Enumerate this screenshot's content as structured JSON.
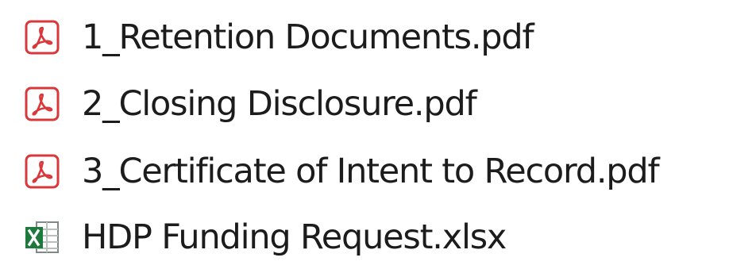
{
  "files": [
    {
      "name": "1_Retention Documents.pdf",
      "icon": "pdf-file-icon"
    },
    {
      "name": "2_Closing Disclosure.pdf",
      "icon": "pdf-file-icon"
    },
    {
      "name": "3_Certificate of Intent to Record.pdf",
      "icon": "pdf-file-icon"
    },
    {
      "name": "HDP Funding Request.xlsx",
      "icon": "excel-file-icon"
    }
  ],
  "colors": {
    "pdf_red": "#d8383a",
    "excel_green": "#1e7a3c",
    "text": "#1c1c1c"
  }
}
